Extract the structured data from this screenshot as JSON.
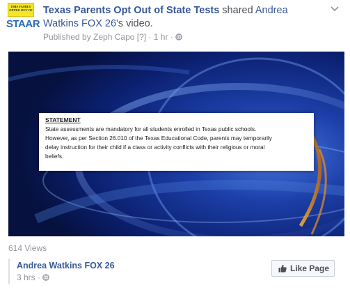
{
  "post": {
    "page_name": "Texas Parents Opt Out of State Tests",
    "action_text": " shared ",
    "shared_person": "Andrea Watkins FOX 26",
    "possessive_suffix": "'s video.",
    "published_by": "Published by Zeph Capo",
    "help_marker": "[?]",
    "separator": "·",
    "time_ago": "1 hr",
    "privacy_icon": "globe-icon",
    "menu_icon": "chevron-down-icon"
  },
  "avatar": {
    "logo_top_text": "THIS FAMILY OPTED OUT OF",
    "logo_bottom_text": "STAAR",
    "colors": {
      "yellow": "#f5e625",
      "blue": "#2b6bb5"
    }
  },
  "video": {
    "statement_title": "STATEMENT",
    "statement_lines": [
      "State assessments are mandatory for all students enrolled in Texas public schools.",
      "However, as per Section 26.010 of the Texas Educational Code, parents may temporarily",
      "delay instruction for their child if a class or activity conflicts with their religious or moral",
      "beliefs."
    ]
  },
  "views": "614 Views",
  "shared_page": {
    "name": "Andrea Watkins FOX 26",
    "time": "3 hrs",
    "separator": "·",
    "privacy_icon": "globe-icon",
    "like_label": "Like Page",
    "like_icon": "thumbs-up-icon"
  },
  "colors": {
    "link": "#365899",
    "meta": "#90949c",
    "text": "#4b4f56"
  }
}
